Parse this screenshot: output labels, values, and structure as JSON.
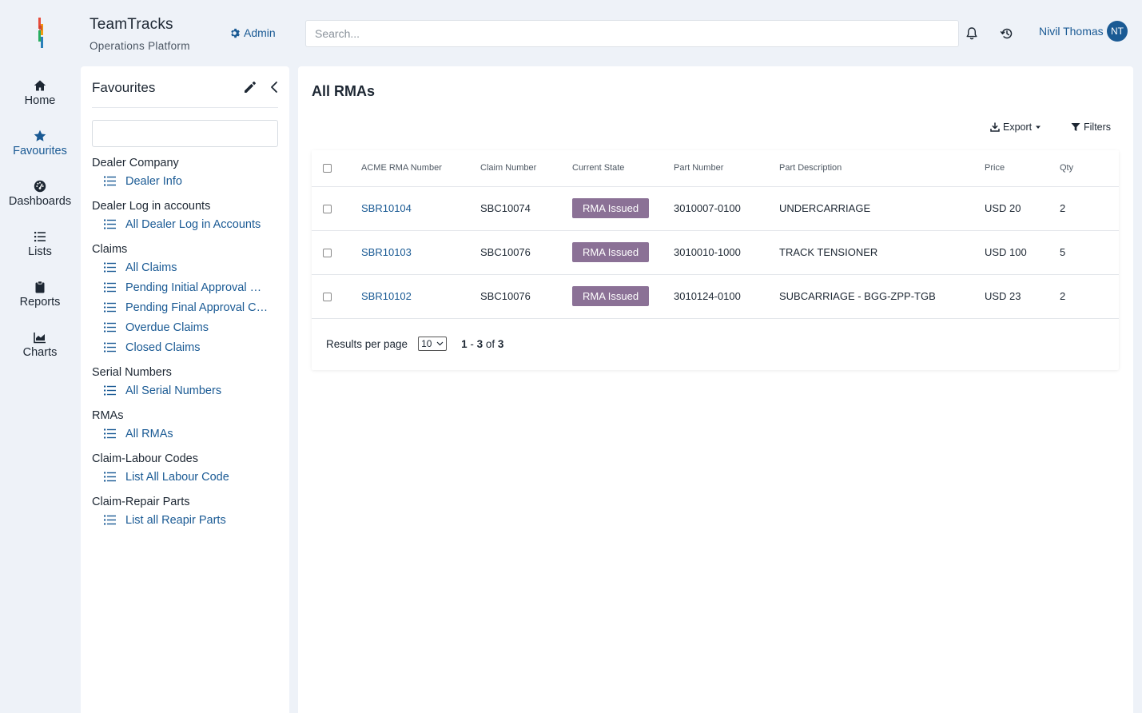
{
  "app": {
    "title": "TeamTracks",
    "subtitle": "Operations Platform",
    "admin_label": "Admin",
    "search_placeholder": "Search...",
    "user_name": "Nivil Thomas",
    "user_initials": "NT",
    "accent_color": "#1a5a94",
    "badge_color": "#8b7196"
  },
  "nav": {
    "items": [
      {
        "label": "Home",
        "icon": "home-icon"
      },
      {
        "label": "Favourites",
        "icon": "star-icon",
        "active": true
      },
      {
        "label": "Dashboards",
        "icon": "dashboard-icon"
      },
      {
        "label": "Lists",
        "icon": "list-icon"
      },
      {
        "label": "Reports",
        "icon": "clipboard-icon"
      },
      {
        "label": "Charts",
        "icon": "chart-icon"
      }
    ]
  },
  "favourites": {
    "title": "Favourites",
    "groups": [
      {
        "title": "Dealer Company",
        "links": [
          "Dealer Info"
        ]
      },
      {
        "title": "Dealer Log in accounts",
        "links": [
          "All Dealer Log in Accounts"
        ]
      },
      {
        "title": "Claims",
        "links": [
          "All Claims",
          "Pending Initial Approval …",
          "Pending Final Approval C…",
          "Overdue Claims",
          "Closed Claims"
        ]
      },
      {
        "title": "Serial Numbers",
        "links": [
          "All Serial Numbers"
        ]
      },
      {
        "title": "RMAs",
        "links": [
          "All RMAs"
        ]
      },
      {
        "title": "Claim-Labour Codes",
        "links": [
          "List All Labour Code"
        ]
      },
      {
        "title": "Claim-Repair Parts",
        "links": [
          "List all Reapir Parts"
        ]
      }
    ]
  },
  "main": {
    "title": "All RMAs",
    "export_label": "Export",
    "filters_label": "Filters",
    "columns": [
      "ACME RMA Number",
      "Claim Number",
      "Current State",
      "Part Number",
      "Part Description",
      "Price",
      "Qty"
    ],
    "rows": [
      [
        "SBR10104",
        "SBC10074",
        "RMA Issued",
        "3010007-0100",
        "UNDERCARRIAGE",
        "USD 20",
        "2"
      ],
      [
        "SBR10103",
        "SBC10076",
        "RMA Issued",
        "3010010-1000",
        "TRACK TENSIONER",
        "USD 100",
        "5"
      ],
      [
        "SBR10102",
        "SBC10076",
        "RMA Issued",
        "3010124-0100",
        "SUBCARRIAGE - BGG-ZPP-TGB",
        "USD 23",
        "2"
      ]
    ],
    "pager": {
      "results_label": "Results per page",
      "per_page": "10",
      "range_start": "1",
      "range_end": "3",
      "total": "3",
      "of_label": "of"
    }
  }
}
